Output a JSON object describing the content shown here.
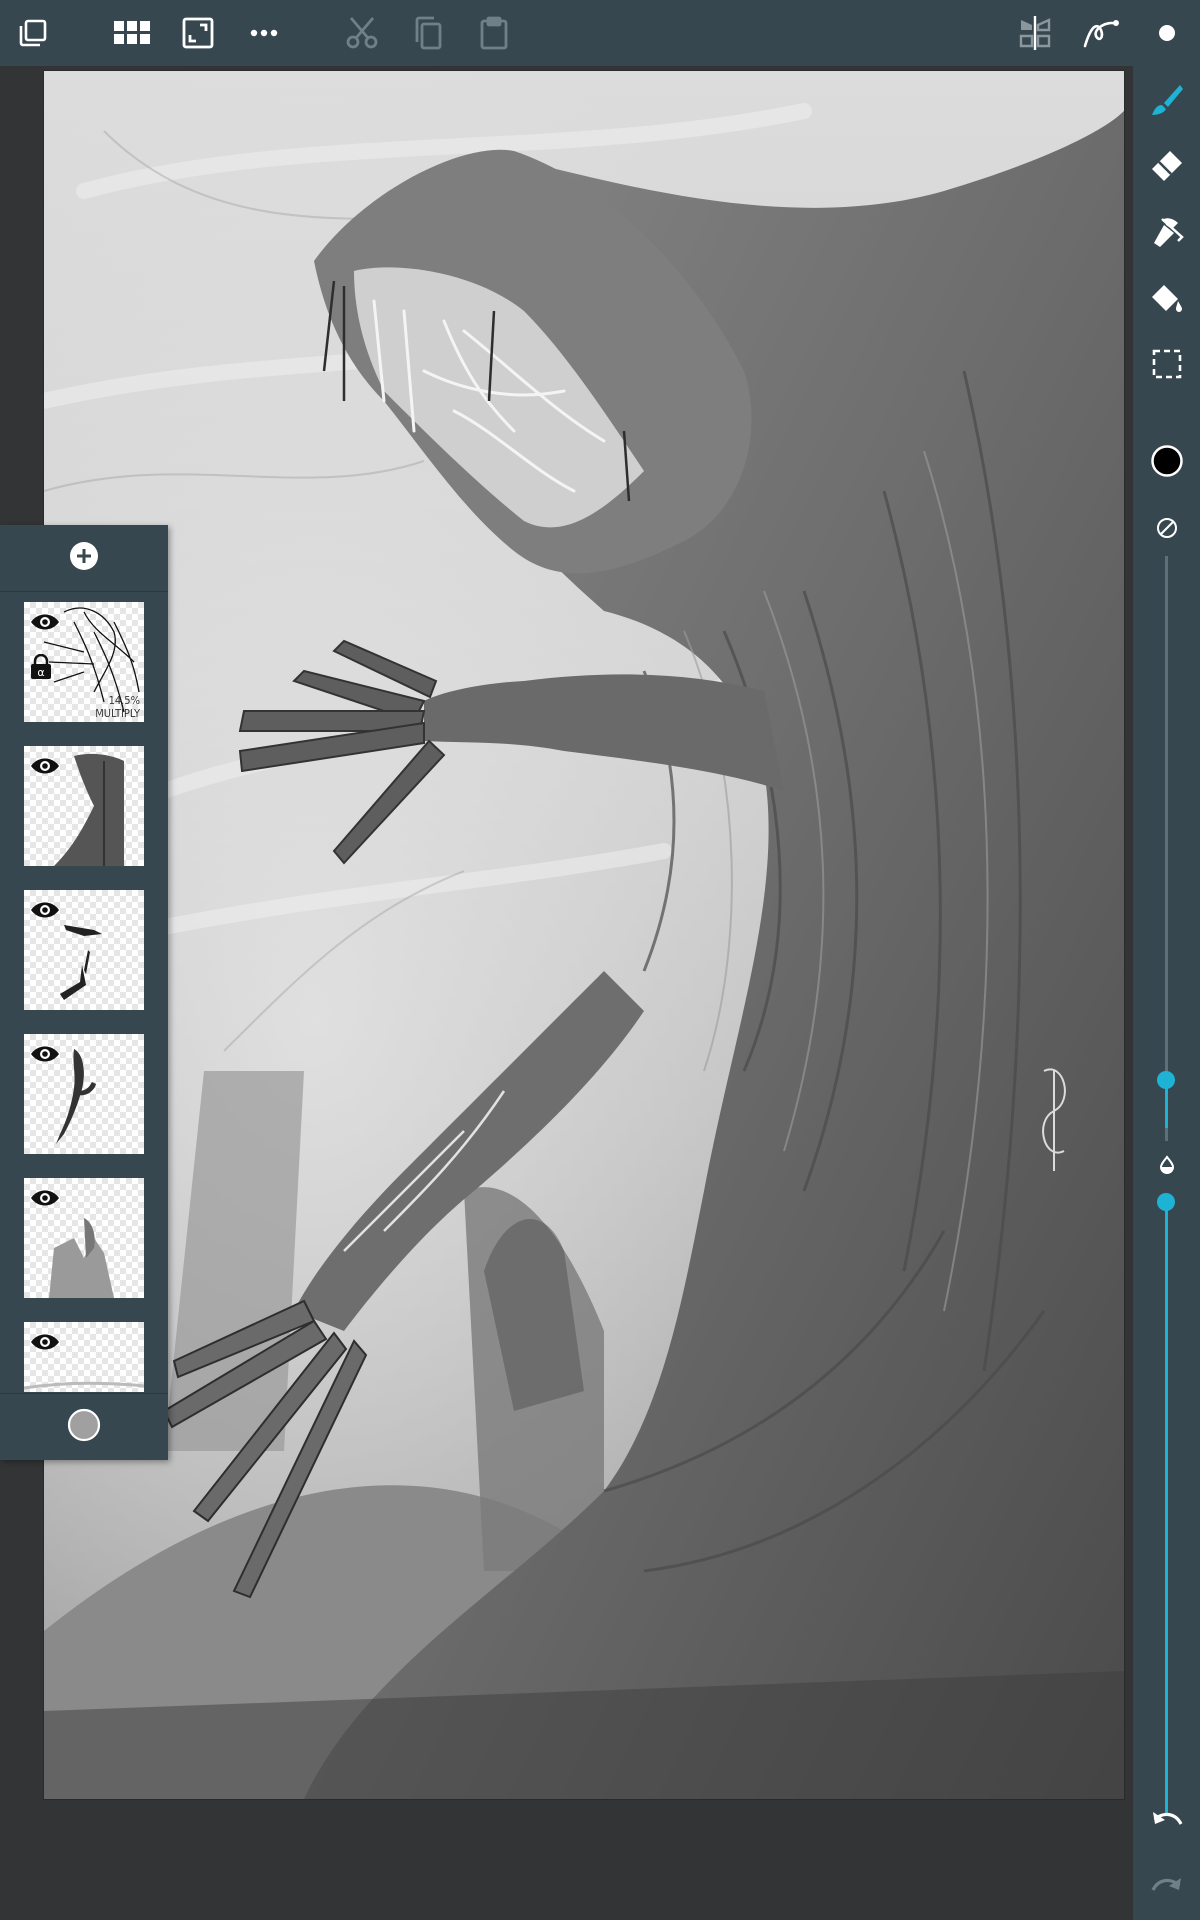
{
  "toolbar": {
    "left_icons": [
      "layers-icon",
      "gallery-icon",
      "fit-screen-icon",
      "more-icon"
    ],
    "edit_icons": [
      "cut-icon",
      "copy-icon",
      "paste-icon"
    ],
    "right_icons": [
      "symmetry-icon",
      "stroke-stabilizer-icon",
      "brush-size-dot-icon"
    ]
  },
  "tools": {
    "items": [
      "brush-icon",
      "eraser-icon",
      "smudge-icon",
      "fill-icon",
      "selection-icon"
    ],
    "active": "brush-icon",
    "current_color": "#000000",
    "accent_color": "#1eb3d4",
    "brush_size_level": 0.08,
    "opacity_level": 1.0
  },
  "layers_panel": {
    "add_icon": "add-layer-icon",
    "layers": [
      {
        "visible": true,
        "alpha_locked": true,
        "opacity_label": "14.5%",
        "blend_label": "MULTIPLY"
      },
      {
        "visible": true,
        "alpha_locked": false,
        "opacity_label": "",
        "blend_label": ""
      },
      {
        "visible": true,
        "alpha_locked": false,
        "opacity_label": "",
        "blend_label": ""
      },
      {
        "visible": true,
        "alpha_locked": false,
        "opacity_label": "",
        "blend_label": ""
      },
      {
        "visible": true,
        "alpha_locked": false,
        "opacity_label": "",
        "blend_label": ""
      },
      {
        "visible": true,
        "alpha_locked": false,
        "opacity_label": "",
        "blend_label": ""
      }
    ],
    "background_color": "#a0a0a0"
  },
  "history": {
    "undo_icon": "undo-icon",
    "redo_icon": "redo-icon"
  }
}
